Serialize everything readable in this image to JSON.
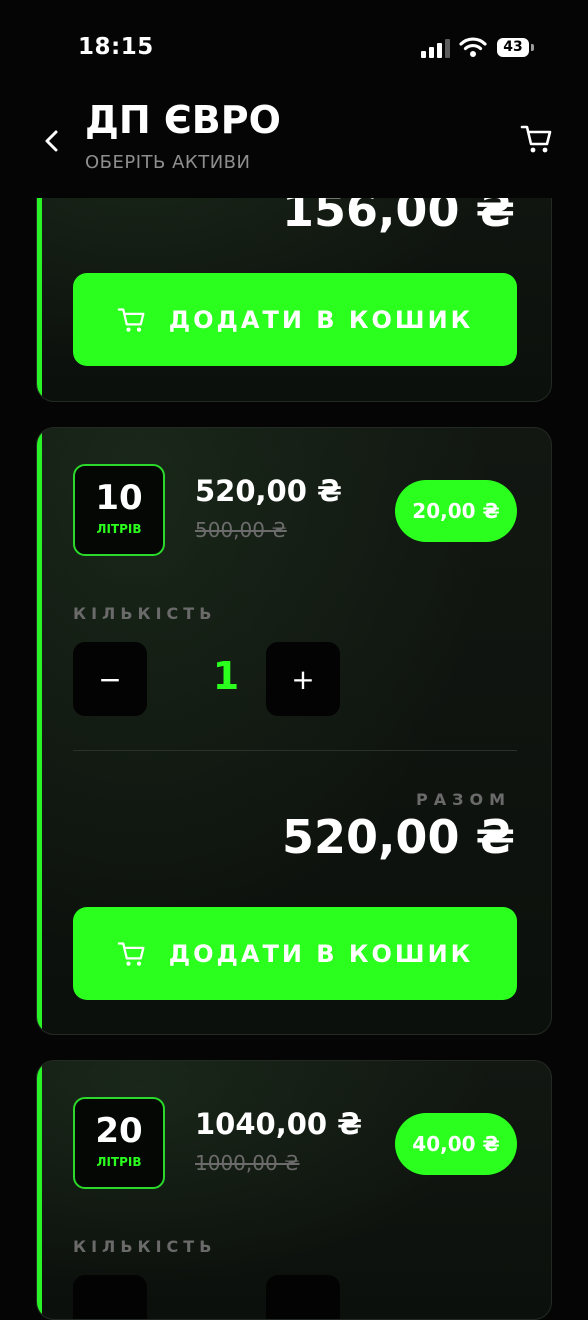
{
  "status": {
    "time": "18:15",
    "battery": "43"
  },
  "header": {
    "title": "ДП ЄВРО",
    "subtitle": "ОБЕРІТЬ АКТИВИ"
  },
  "card_top": {
    "total": "156,00 ₴",
    "add_label": "ДОДАТИ В КОШИК"
  },
  "card_10": {
    "volume": "10",
    "unit": "ЛІТРІВ",
    "price": "520,00 ₴",
    "old_price": "500,00 ₴",
    "discount": "20,00 ₴",
    "qty_label": "КІЛЬКІСТЬ",
    "minus": "−",
    "qty": "1",
    "plus": "+",
    "total_label": "РАЗОМ",
    "total": "520,00 ₴",
    "add_label": "ДОДАТИ В КОШИК"
  },
  "card_20": {
    "volume": "20",
    "unit": "ЛІТРІВ",
    "price": "1040,00 ₴",
    "old_price": "1000,00 ₴",
    "discount": "40,00 ₴",
    "qty_label": "КІЛЬКІСТЬ"
  },
  "colors": {
    "accent": "#2aff1e",
    "background": "#050505",
    "card": "#101510"
  },
  "icons": [
    "back-chevron-icon",
    "cart-icon",
    "signal-icon",
    "wifi-icon",
    "battery-icon"
  ]
}
